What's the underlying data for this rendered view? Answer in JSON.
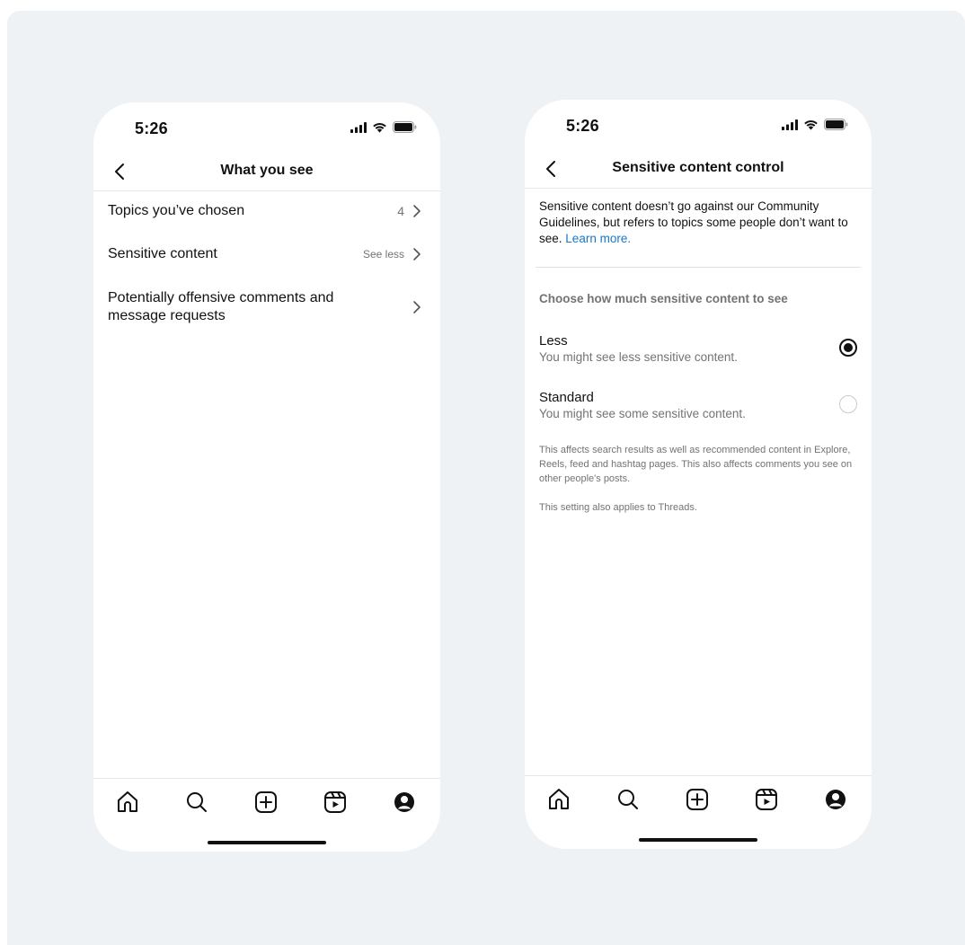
{
  "phones": [
    {
      "status": {
        "time": "5:26"
      },
      "nav": {
        "title": "What you see"
      },
      "menu": [
        {
          "label": "Topics you’ve chosen",
          "value": "4"
        },
        {
          "label": "Sensitive content",
          "value": "See less"
        },
        {
          "label": "Potentially offensive comments and message requests",
          "value": ""
        }
      ],
      "tabs": [
        "home-icon",
        "search-icon",
        "create-icon",
        "reels-icon",
        "profile-icon"
      ]
    },
    {
      "status": {
        "time": "5:26"
      },
      "nav": {
        "title": "Sensitive content control"
      },
      "intro": {
        "text": "Sensitive content doesn’t go against our Community Guidelines, but refers to topics some people don’t want to see.",
        "link": "Learn more."
      },
      "section_title": "Choose how much sensitive content to see",
      "options": [
        {
          "title": "Less",
          "subtitle": "You might see less sensitive content.",
          "selected": true
        },
        {
          "title": "Standard",
          "subtitle": "You might see some sensitive content.",
          "selected": false
        }
      ],
      "notes": [
        "This affects search results as well as recommended content in Explore, Reels, feed and hashtag pages. This also affects comments you see on other people's posts.",
        "This setting also applies to Threads."
      ],
      "tabs": [
        "home-icon",
        "search-icon",
        "create-icon",
        "reels-icon",
        "profile-icon"
      ]
    }
  ],
  "colors": {
    "background": "#eff2f5",
    "link": "#1877c9",
    "secondary_text": "#737373"
  }
}
